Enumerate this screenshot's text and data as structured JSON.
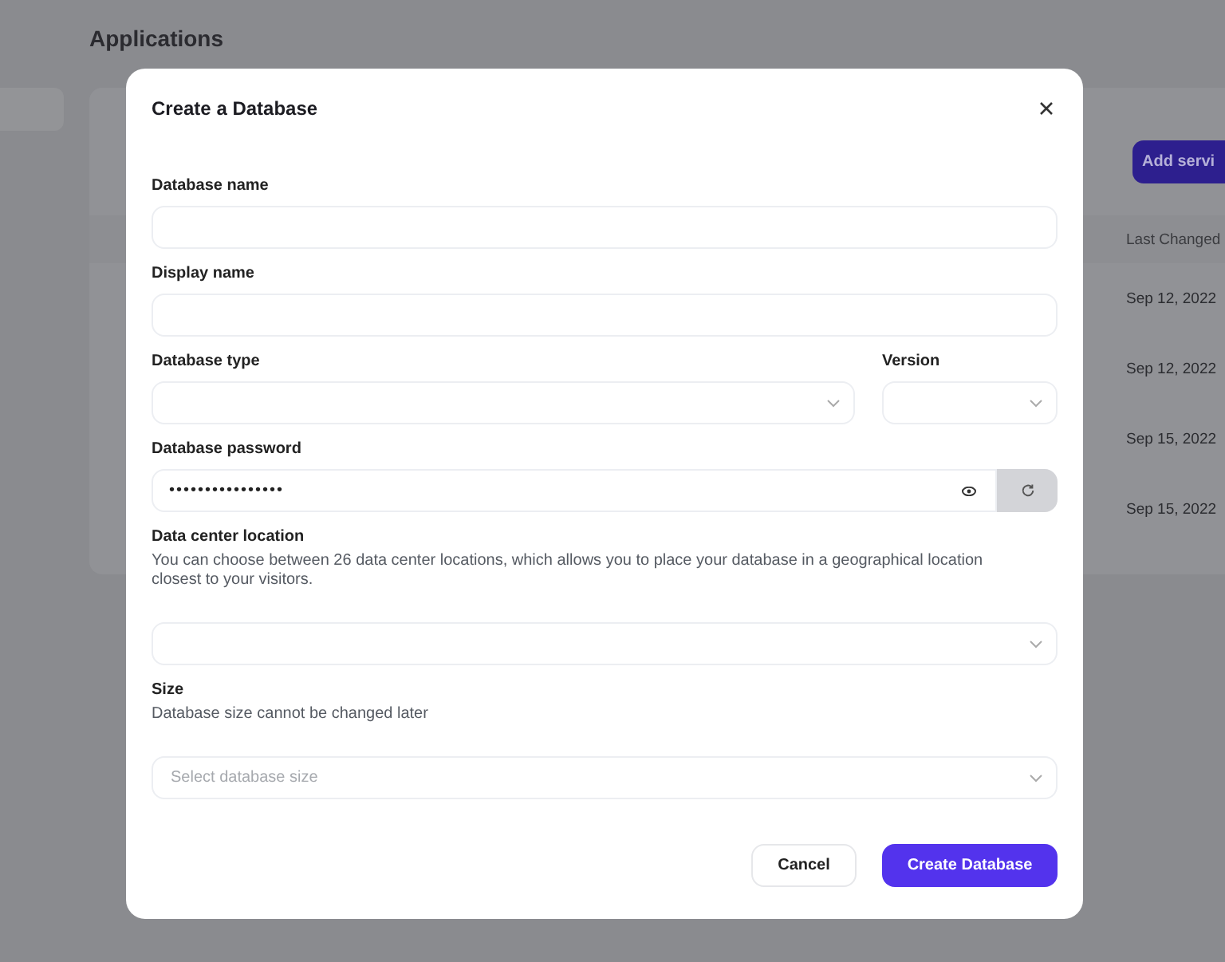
{
  "page": {
    "title": "Applications",
    "add_button": "Add servi",
    "table": {
      "columns": [
        "Last Changed"
      ],
      "rows": [
        [
          "Sep 12, 2022"
        ],
        [
          "Sep 12, 2022"
        ],
        [
          "Sep 15, 2022"
        ],
        [
          "Sep 15, 2022"
        ]
      ]
    }
  },
  "dialog": {
    "title": "Create a Database",
    "fields": [
      {
        "kind": "text",
        "label": "Database name"
      },
      {
        "kind": "text",
        "label": "Display name"
      },
      {
        "kind": "select_pair",
        "items": [
          {
            "label": "Database type"
          },
          {
            "label": "Version"
          }
        ]
      },
      {
        "kind": "password",
        "label": "Database password",
        "value": "••••••••••••••••"
      },
      {
        "kind": "select",
        "label": "Data center location",
        "help": "You can choose between 26 data center locations, which allows you to place your database in a geographical location closest to your visitors."
      },
      {
        "kind": "select",
        "label": "Size",
        "help": "Database size cannot be changed later",
        "placeholder": "Select database size"
      }
    ],
    "buttons": [
      {
        "kind": "secondary",
        "label": "Cancel"
      },
      {
        "kind": "primary",
        "label": "Create Database"
      }
    ]
  }
}
